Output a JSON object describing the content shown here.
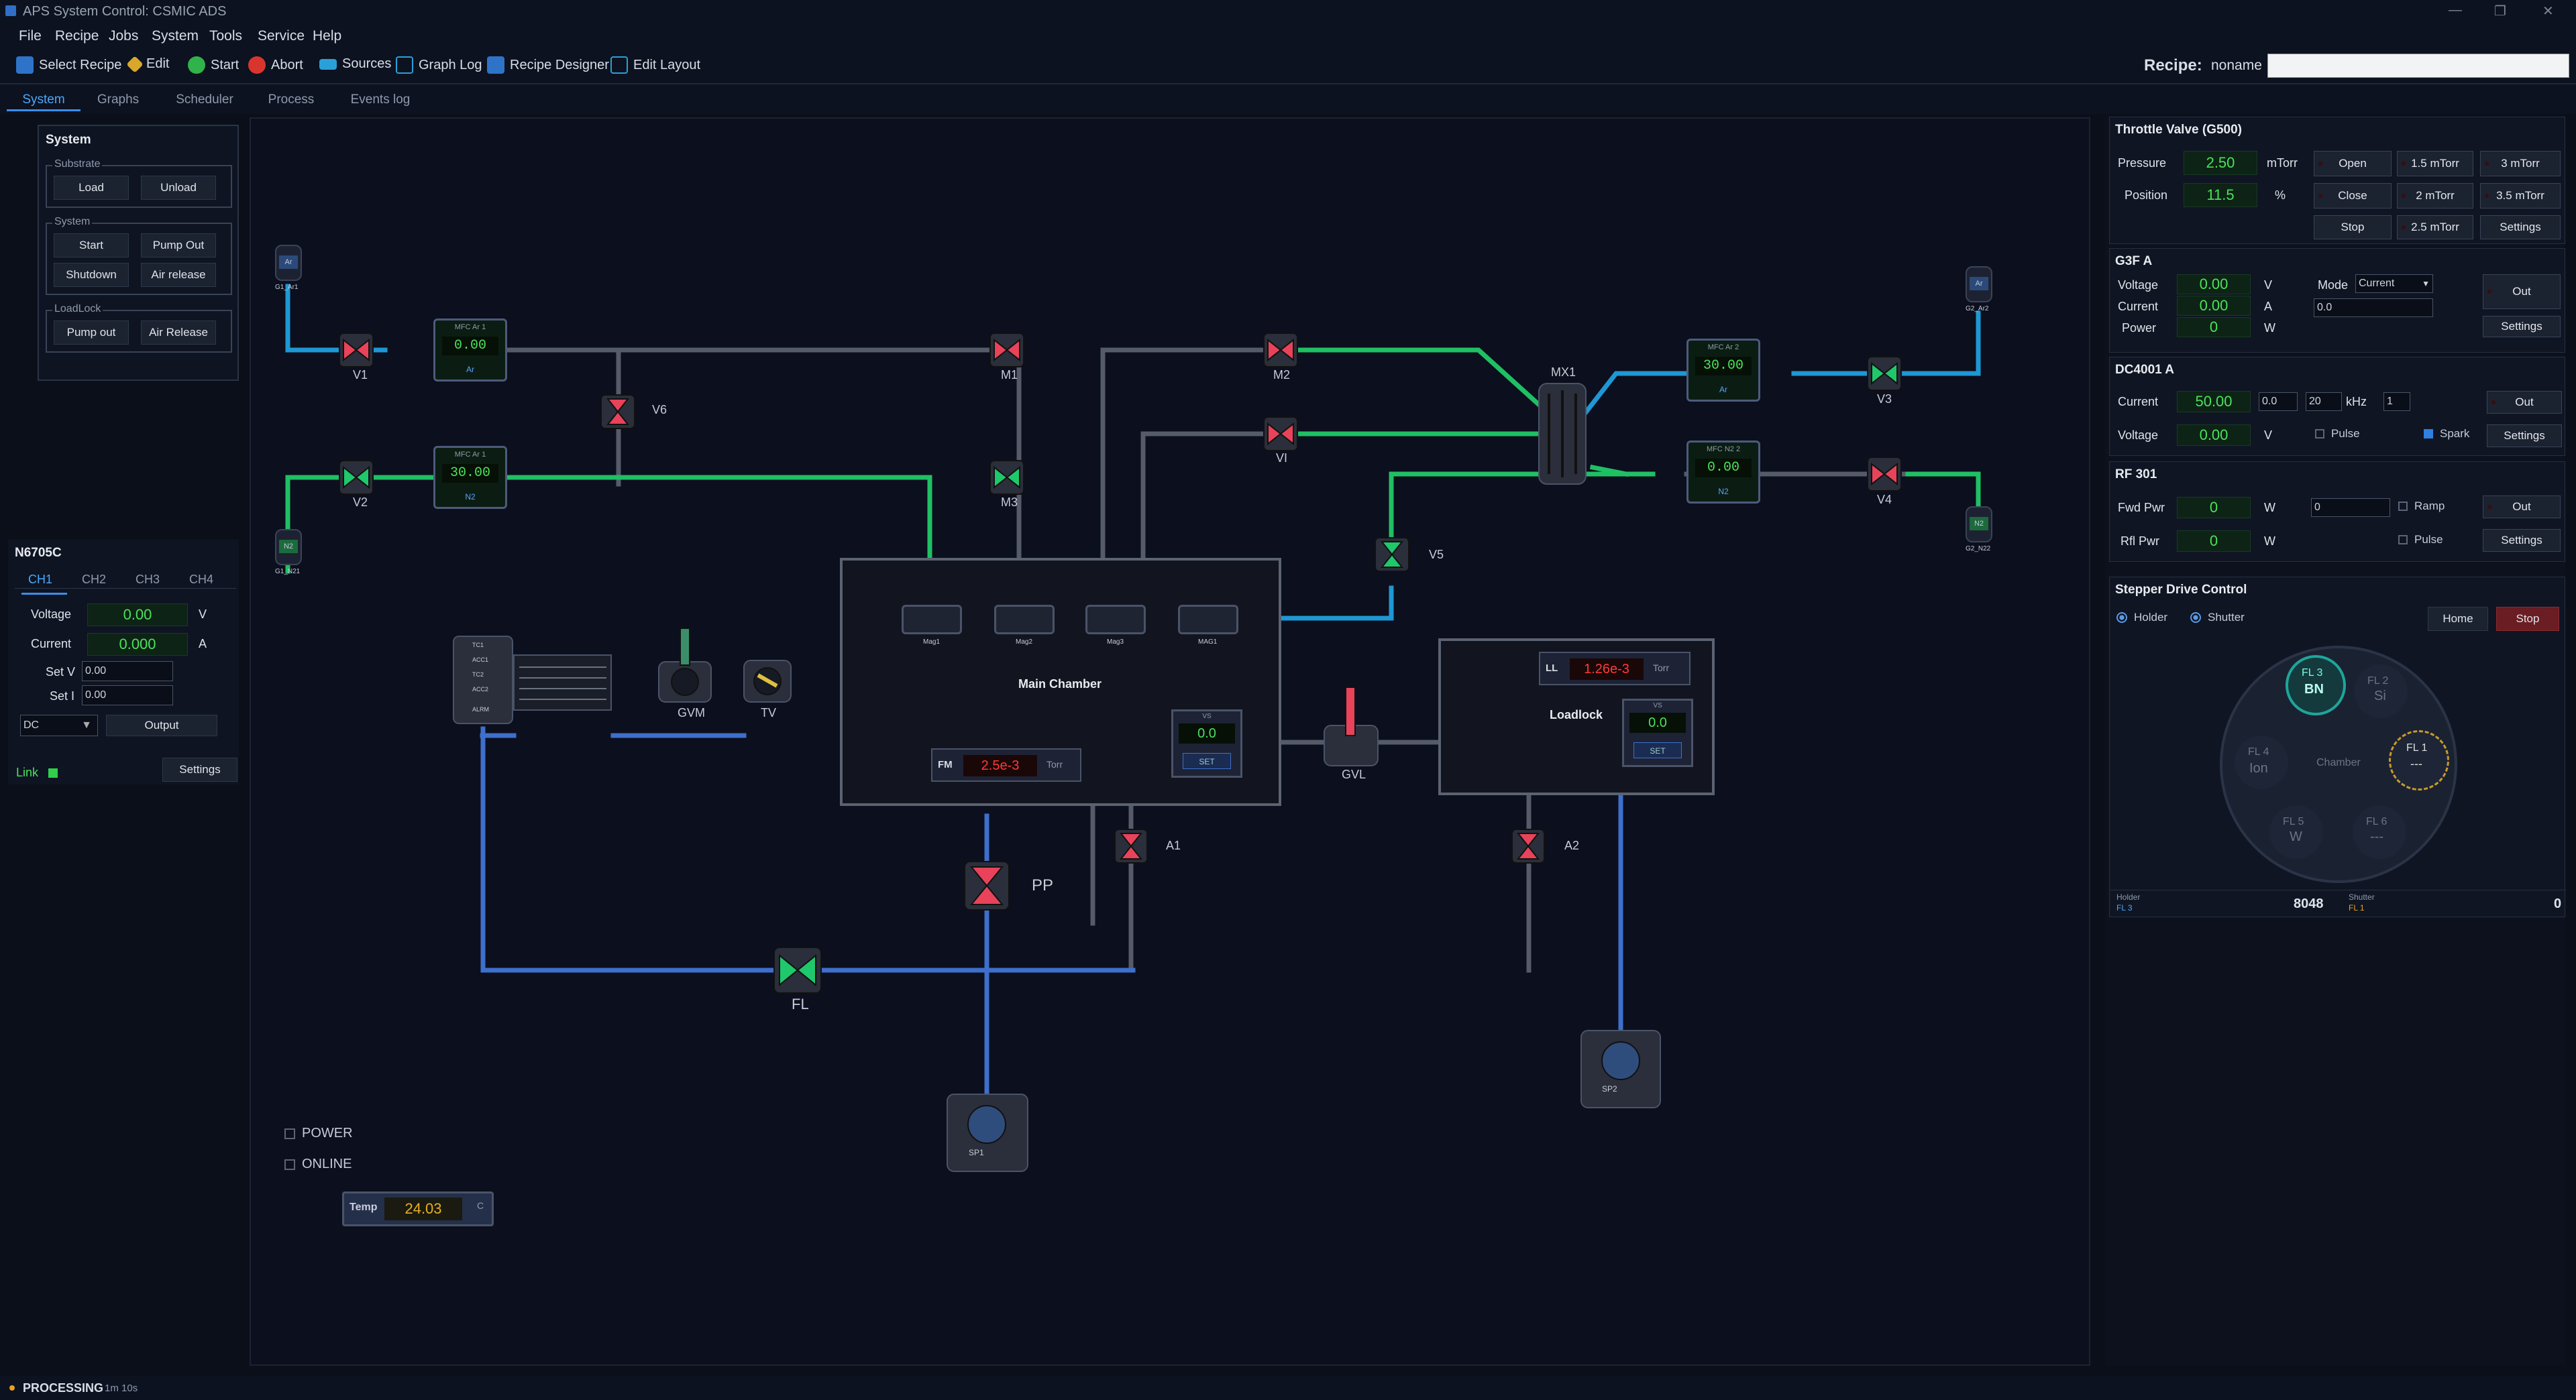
{
  "window": {
    "title": "APS System Control: CSMIC ADS",
    "controls": [
      "—",
      "❐",
      "✕"
    ]
  },
  "menu": [
    "File",
    "Recipe",
    "Jobs",
    "System",
    "Tools",
    "Service",
    "Help"
  ],
  "toolbar": {
    "select_recipe": "Select Recipe",
    "edit": "Edit",
    "start": "Start",
    "abort": "Abort",
    "sources": "Sources",
    "graph_log": "Graph Log",
    "recipe_designer": "Recipe Designer",
    "edit_layout": "Edit Layout",
    "recipe_label": "Recipe:",
    "recipe_value": "noname"
  },
  "tabs": [
    "System",
    "Graphs",
    "Scheduler",
    "Process",
    "Events log"
  ],
  "system_panel": {
    "title": "System",
    "substrate": {
      "label": "Substrate",
      "load": "Load",
      "unload": "Unload"
    },
    "system": {
      "label": "System",
      "start": "Start",
      "pump_out": "Pump Out",
      "shutdown": "Shutdown",
      "air_release": "Air release"
    },
    "loadlock": {
      "label": "LoadLock",
      "pump_out": "Pump out",
      "air_release": "Air Release"
    }
  },
  "psu": {
    "title": "N6705C",
    "channels": [
      "CH1",
      "CH2",
      "CH3",
      "CH4"
    ],
    "voltage_label": "Voltage",
    "voltage": "0.00",
    "voltage_unit": "V",
    "current_label": "Current",
    "current": "0.000",
    "current_unit": "A",
    "setv_label": "Set V",
    "setv": "0.00",
    "seti_label": "Set I",
    "seti": "0.00",
    "mode": "DC",
    "output": "Output",
    "link": "Link",
    "settings": "Settings"
  },
  "diagram": {
    "valves": {
      "v1": "V1",
      "v2": "V2",
      "v6": "V6",
      "m1": "M1",
      "m3": "M3",
      "m2": "M2",
      "vi": "VI",
      "v3": "V3",
      "v4": "V4",
      "v5": "V5",
      "mx1": "MX1",
      "a1": "A1",
      "a2": "A2",
      "pp": "PP",
      "fl": "FL",
      "gvm": "GVM",
      "tv": "TV",
      "gvl": "GVL"
    },
    "mfc": {
      "mfc1_title": "MFC Ar 1",
      "mfc1_val": "0.00",
      "mfc1_gas": "Ar",
      "mfc2_title": "MFC Ar 1",
      "mfc2_val": "30.00",
      "mfc2_gas": "N2",
      "mfc3_title": "MFC Ar 2",
      "mfc3_val": "30.00",
      "mfc3_gas": "Ar",
      "mfc4_title": "MFC N2 2",
      "mfc4_val": "0.00",
      "mfc4_gas": "N2"
    },
    "gas": {
      "ar1": "Ar",
      "ar1_lbl": "G1_Ar1",
      "n2_1": "N2",
      "n2_1_lbl": "G1_N21",
      "ar2": "Ar",
      "ar2_lbl": "G2_Ar2",
      "n2_2": "N2",
      "n2_2_lbl": "G2_N22"
    },
    "main_chamber": {
      "label": "Main Chamber",
      "mags": [
        "Mag1",
        "Mag2",
        "Mag3",
        "MAG1"
      ],
      "fm_label": "FM",
      "fm_value": "2.5e-3",
      "fm_unit": "Torr",
      "vs_label": "VS",
      "vs_value": "0.0",
      "vs_set": "SET"
    },
    "loadlock": {
      "label": "Loadlock",
      "ll_label": "LL",
      "ll_value": "1.26e-3",
      "ll_unit": "Torr",
      "vs_label": "VS",
      "vs_value": "0.0",
      "vs_set": "SET"
    },
    "pumps": {
      "sp1": "SP1",
      "sp2": "SP2"
    },
    "rack": [
      "TC1",
      "ACC1",
      "TC2",
      "ACC2",
      "ALRM"
    ],
    "power": "POWER",
    "online": "ONLINE",
    "temp_label": "Temp",
    "temp_value": "24.03",
    "temp_unit": "C"
  },
  "throttle": {
    "title": "Throttle Valve (G500)",
    "pressure_label": "Pressure",
    "pressure": "2.50",
    "pressure_unit": "mTorr",
    "position_label": "Position",
    "position": "11.5",
    "position_unit": "%",
    "open": "Open",
    "close": "Close",
    "stop": "Stop",
    "p15": "1.5 mTorr",
    "p3": "3 mTorr",
    "p2": "2 mTorr",
    "p35": "3.5 mTorr",
    "p25": "2.5 mTorr",
    "settings": "Settings"
  },
  "g3f": {
    "title": "G3F A",
    "voltage_label": "Voltage",
    "voltage": "0.00",
    "voltage_unit": "V",
    "current_label": "Current",
    "current": "0.00",
    "current_unit": "A",
    "power_label": "Power",
    "power": "0",
    "power_unit": "W",
    "mode_label": "Mode",
    "mode": "Current",
    "setpoint": "0.0",
    "out": "Out",
    "settings": "Settings"
  },
  "dc4001": {
    "title": "DC4001 A",
    "current_label": "Current",
    "current": "50.00",
    "voltage_label": "Voltage",
    "voltage": "0.00",
    "voltage_unit": "V",
    "in1": "0.0",
    "in2": "20",
    "khz": "kHz",
    "in3": "1",
    "pulse": "Pulse",
    "spark": "Spark",
    "out": "Out",
    "settings": "Settings"
  },
  "rf301": {
    "title": "RF 301",
    "fwd_label": "Fwd Pwr",
    "fwd": "0",
    "fwd_unit": "W",
    "rfl_label": "Rfl Pwr",
    "rfl": "0",
    "rfl_unit": "W",
    "setpoint": "0",
    "ramp": "Ramp",
    "pulse": "Pulse",
    "out": "Out",
    "settings": "Settings"
  },
  "stepper": {
    "title": "Stepper Drive Control",
    "holder": "Holder",
    "shutter": "Shutter",
    "home": "Home",
    "stop": "Stop",
    "chamber": "Chamber",
    "slots": [
      {
        "id": "FL 3",
        "name": "BN"
      },
      {
        "id": "FL 2",
        "name": "Si"
      },
      {
        "id": "FL 4",
        "name": "Ion"
      },
      {
        "id": "FL 1",
        "name": "---"
      },
      {
        "id": "FL 5",
        "name": "W"
      },
      {
        "id": "FL 6",
        "name": "---"
      }
    ],
    "holder_label": "Holder",
    "holder_pos": "FL 3",
    "holder_value": "8048",
    "shutter_label": "Shutter",
    "shutter_pos": "FL 1",
    "shutter_value": "0"
  },
  "status": {
    "state": "PROCESSING",
    "time": "1m 10s"
  },
  "colors": {
    "accent": "#3b8ee8",
    "green_pipe": "#23c25a",
    "blue_pipe": "#1e9ad6",
    "valve_red": "#e8435a",
    "valve_green": "#1fc86b"
  }
}
